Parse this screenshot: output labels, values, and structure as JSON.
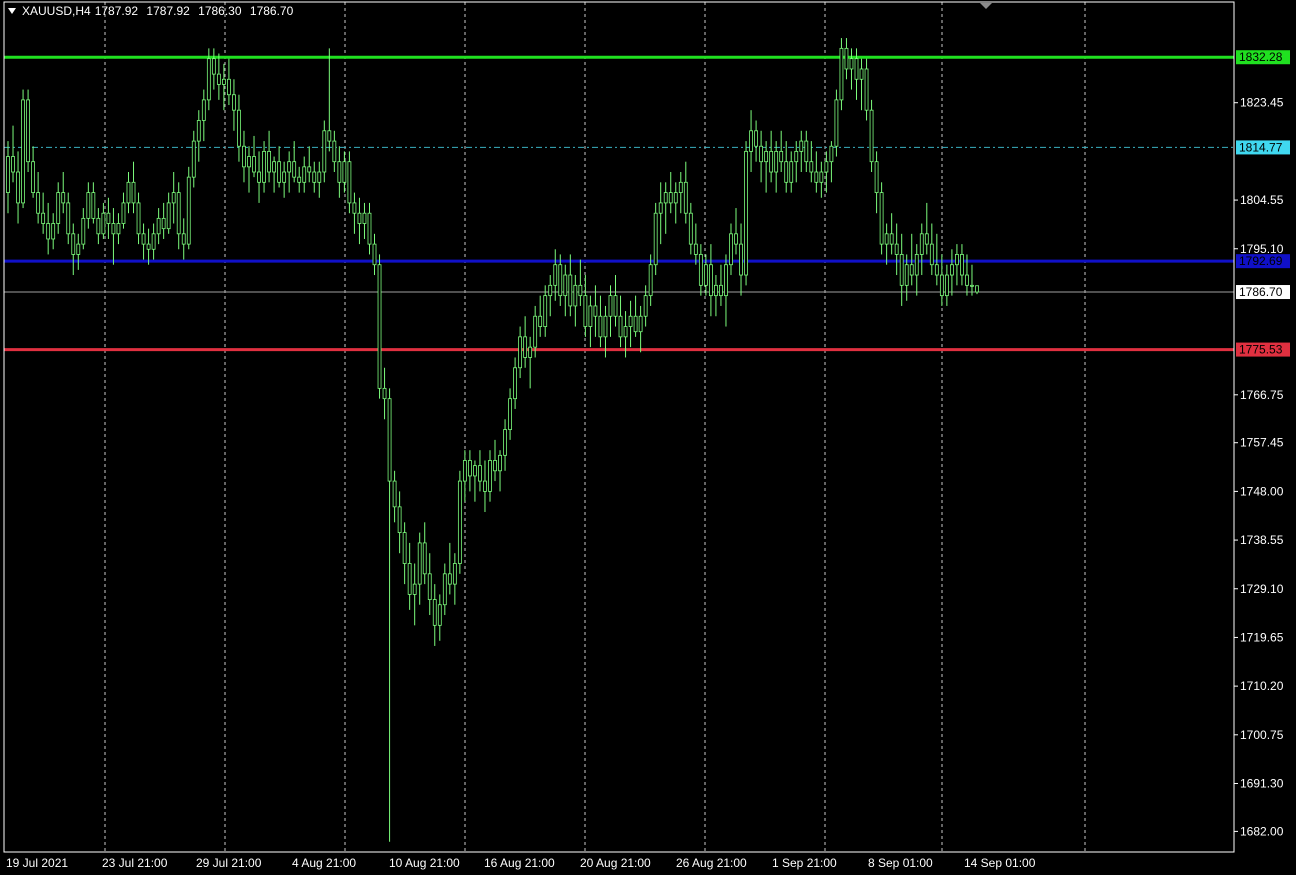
{
  "header": {
    "symbol_timeframe": "XAUUSD,H4",
    "open": "1787.92",
    "high": "1787.92",
    "low": "1786.30",
    "close": "1786.70"
  },
  "colors": {
    "background": "#000000",
    "frame": "#ffffff",
    "grid": "#c8c8c8",
    "candle": "#7cfc7c",
    "resistance_line": "#20e020",
    "dashed_level": "#3ab0c0",
    "blue_level": "#1010c8",
    "red_level": "#e03040",
    "bid_line": "#a0a0a0"
  },
  "chart_data": {
    "type": "candlestick",
    "symbol": "XAUUSD",
    "timeframe": "H4",
    "ylim": [
      1678.0,
      1843.0
    ],
    "y_ticks": [
      "1823.45",
      "1804.55",
      "1795.10",
      "1766.75",
      "1757.45",
      "1748.00",
      "1738.55",
      "1729.10",
      "1719.65",
      "1710.20",
      "1700.75",
      "1691.30",
      "1682.00"
    ],
    "x_ticks": [
      "19 Jul 2021",
      "23 Jul 21:00",
      "29 Jul 21:00",
      "4 Aug 21:00",
      "10 Aug 21:00",
      "16 Aug 21:00",
      "20 Aug 21:00",
      "26 Aug 21:00",
      "1 Sep 21:00",
      "8 Sep 01:00",
      "14 Sep 01:00"
    ],
    "grid": "vertical dashed",
    "levels": [
      {
        "id": "green",
        "price": "1832.28",
        "value": 1832.28,
        "style": "solid",
        "color": "#20e020",
        "label_bg": "#20e020",
        "label_fg": "#000000"
      },
      {
        "id": "cyan",
        "price": "1814.77",
        "value": 1814.77,
        "style": "dashdot",
        "color": "#3ab0c0",
        "label_bg": "#40d8f0",
        "label_fg": "#000000"
      },
      {
        "id": "blue",
        "price": "1792.69",
        "value": 1792.69,
        "style": "solid",
        "color": "#1010c8",
        "label_bg": "#1010c8",
        "label_fg": "#000000"
      },
      {
        "id": "red",
        "price": "1775.53",
        "value": 1775.53,
        "style": "solid",
        "color": "#e03040",
        "label_bg": "#e03040",
        "label_fg": "#000000"
      },
      {
        "id": "bid",
        "price": "1786.70",
        "value": 1786.7,
        "style": "thin",
        "color": "#a0a0a0",
        "label_bg": "#ffffff",
        "label_fg": "#000000"
      }
    ],
    "candles": [
      [
        1806,
        1816,
        1802,
        1813
      ],
      [
        1813,
        1819,
        1808,
        1810
      ],
      [
        1810,
        1814,
        1800,
        1804
      ],
      [
        1804,
        1826,
        1803,
        1824
      ],
      [
        1824,
        1826,
        1810,
        1812
      ],
      [
        1812,
        1815,
        1805,
        1806
      ],
      [
        1806,
        1810,
        1800,
        1802
      ],
      [
        1802,
        1806,
        1798,
        1800
      ],
      [
        1800,
        1804,
        1794,
        1797
      ],
      [
        1797,
        1802,
        1795,
        1800
      ],
      [
        1800,
        1808,
        1798,
        1806
      ],
      [
        1806,
        1810,
        1802,
        1804
      ],
      [
        1804,
        1806,
        1796,
        1798
      ],
      [
        1798,
        1800,
        1790,
        1794
      ],
      [
        1794,
        1798,
        1791,
        1796
      ],
      [
        1796,
        1803,
        1795,
        1801
      ],
      [
        1801,
        1808,
        1799,
        1806
      ],
      [
        1806,
        1808,
        1800,
        1801
      ],
      [
        1801,
        1803,
        1796,
        1798
      ],
      [
        1798,
        1804,
        1797,
        1802
      ],
      [
        1802,
        1805,
        1797,
        1800
      ],
      [
        1800,
        1803,
        1792,
        1798
      ],
      [
        1798,
        1802,
        1796,
        1800
      ],
      [
        1800,
        1806,
        1799,
        1804
      ],
      [
        1804,
        1810,
        1802,
        1808
      ],
      [
        1808,
        1812,
        1802,
        1804
      ],
      [
        1804,
        1806,
        1796,
        1798
      ],
      [
        1798,
        1800,
        1793,
        1796
      ],
      [
        1796,
        1799,
        1792,
        1795
      ],
      [
        1795,
        1800,
        1793,
        1798
      ],
      [
        1798,
        1803,
        1796,
        1801
      ],
      [
        1801,
        1804,
        1797,
        1799
      ],
      [
        1799,
        1806,
        1798,
        1804
      ],
      [
        1804,
        1810,
        1800,
        1806
      ],
      [
        1806,
        1808,
        1795,
        1798
      ],
      [
        1798,
        1801,
        1793,
        1796
      ],
      [
        1796,
        1811,
        1795,
        1809
      ],
      [
        1809,
        1818,
        1807,
        1816
      ],
      [
        1816,
        1822,
        1812,
        1820
      ],
      [
        1820,
        1826,
        1816,
        1824
      ],
      [
        1824,
        1834,
        1822,
        1832
      ],
      [
        1832,
        1834,
        1826,
        1829
      ],
      [
        1829,
        1833,
        1824,
        1827
      ],
      [
        1827,
        1831,
        1822,
        1828
      ],
      [
        1828,
        1832,
        1823,
        1825
      ],
      [
        1825,
        1828,
        1818,
        1822
      ],
      [
        1822,
        1825,
        1812,
        1815
      ],
      [
        1815,
        1818,
        1808,
        1811
      ],
      [
        1811,
        1815,
        1806,
        1813
      ],
      [
        1813,
        1817,
        1809,
        1810
      ],
      [
        1810,
        1814,
        1804,
        1808
      ],
      [
        1808,
        1816,
        1806,
        1814
      ],
      [
        1814,
        1818,
        1808,
        1810
      ],
      [
        1810,
        1813,
        1806,
        1812
      ],
      [
        1812,
        1815,
        1807,
        1808
      ],
      [
        1808,
        1812,
        1805,
        1810
      ],
      [
        1810,
        1814,
        1806,
        1812
      ],
      [
        1812,
        1816,
        1808,
        1809
      ],
      [
        1809,
        1811,
        1806,
        1808
      ],
      [
        1808,
        1813,
        1806,
        1811
      ],
      [
        1811,
        1815,
        1808,
        1810
      ],
      [
        1810,
        1812,
        1806,
        1808
      ],
      [
        1808,
        1812,
        1805,
        1810
      ],
      [
        1810,
        1820,
        1808,
        1818
      ],
      [
        1818,
        1834,
        1814,
        1816
      ],
      [
        1816,
        1818,
        1810,
        1812
      ],
      [
        1812,
        1815,
        1805,
        1808
      ],
      [
        1808,
        1814,
        1806,
        1812
      ],
      [
        1812,
        1814,
        1802,
        1804
      ],
      [
        1804,
        1806,
        1798,
        1802
      ],
      [
        1802,
        1805,
        1796,
        1800
      ],
      [
        1800,
        1804,
        1797,
        1802
      ],
      [
        1802,
        1804,
        1794,
        1796
      ],
      [
        1796,
        1798,
        1790,
        1792
      ],
      [
        1792,
        1794,
        1766,
        1768
      ],
      [
        1768,
        1772,
        1762,
        1766
      ],
      [
        1766,
        1768,
        1680,
        1750
      ],
      [
        1750,
        1752,
        1742,
        1745
      ],
      [
        1745,
        1748,
        1736,
        1740
      ],
      [
        1740,
        1742,
        1730,
        1734
      ],
      [
        1734,
        1738,
        1725,
        1728
      ],
      [
        1728,
        1734,
        1722,
        1730
      ],
      [
        1730,
        1740,
        1726,
        1738
      ],
      [
        1738,
        1742,
        1730,
        1732
      ],
      [
        1732,
        1736,
        1724,
        1727
      ],
      [
        1727,
        1730,
        1718,
        1722
      ],
      [
        1722,
        1728,
        1719,
        1726
      ],
      [
        1726,
        1734,
        1724,
        1732
      ],
      [
        1732,
        1738,
        1728,
        1730
      ],
      [
        1730,
        1736,
        1726,
        1734
      ],
      [
        1734,
        1752,
        1732,
        1750
      ],
      [
        1750,
        1756,
        1746,
        1754
      ],
      [
        1754,
        1756,
        1748,
        1751
      ],
      [
        1751,
        1754,
        1746,
        1753
      ],
      [
        1753,
        1756,
        1748,
        1750
      ],
      [
        1750,
        1754,
        1744,
        1748
      ],
      [
        1748,
        1756,
        1746,
        1754
      ],
      [
        1754,
        1758,
        1750,
        1752
      ],
      [
        1752,
        1756,
        1748,
        1755
      ],
      [
        1755,
        1762,
        1752,
        1760
      ],
      [
        1760,
        1768,
        1758,
        1766
      ],
      [
        1766,
        1774,
        1764,
        1772
      ],
      [
        1772,
        1780,
        1770,
        1778
      ],
      [
        1778,
        1782,
        1772,
        1774
      ],
      [
        1774,
        1778,
        1768,
        1776
      ],
      [
        1776,
        1784,
        1774,
        1782
      ],
      [
        1782,
        1786,
        1778,
        1780
      ],
      [
        1780,
        1788,
        1778,
        1786
      ],
      [
        1786,
        1790,
        1782,
        1788
      ],
      [
        1788,
        1795,
        1785,
        1792
      ],
      [
        1792,
        1794,
        1784,
        1786
      ],
      [
        1786,
        1792,
        1782,
        1790
      ],
      [
        1790,
        1794,
        1782,
        1784
      ],
      [
        1784,
        1790,
        1780,
        1788
      ],
      [
        1788,
        1793,
        1784,
        1786
      ],
      [
        1786,
        1790,
        1778,
        1780
      ],
      [
        1780,
        1786,
        1776,
        1784
      ],
      [
        1784,
        1788,
        1778,
        1782
      ],
      [
        1782,
        1786,
        1776,
        1778
      ],
      [
        1778,
        1784,
        1774,
        1782
      ],
      [
        1782,
        1788,
        1778,
        1786
      ],
      [
        1786,
        1790,
        1780,
        1782
      ],
      [
        1782,
        1786,
        1776,
        1778
      ],
      [
        1778,
        1783,
        1774,
        1780
      ],
      [
        1780,
        1785,
        1776,
        1782
      ],
      [
        1782,
        1786,
        1778,
        1779
      ],
      [
        1779,
        1784,
        1775,
        1782
      ],
      [
        1782,
        1788,
        1780,
        1786
      ],
      [
        1786,
        1794,
        1784,
        1792
      ],
      [
        1792,
        1804,
        1790,
        1802
      ],
      [
        1802,
        1808,
        1796,
        1804
      ],
      [
        1804,
        1808,
        1798,
        1806
      ],
      [
        1806,
        1810,
        1802,
        1804
      ],
      [
        1804,
        1808,
        1800,
        1806
      ],
      [
        1806,
        1810,
        1802,
        1808
      ],
      [
        1808,
        1812,
        1800,
        1802
      ],
      [
        1802,
        1804,
        1794,
        1796
      ],
      [
        1796,
        1800,
        1792,
        1794
      ],
      [
        1794,
        1796,
        1786,
        1788
      ],
      [
        1788,
        1794,
        1786,
        1792
      ],
      [
        1792,
        1796,
        1782,
        1786
      ],
      [
        1786,
        1790,
        1782,
        1788
      ],
      [
        1788,
        1792,
        1784,
        1786
      ],
      [
        1786,
        1794,
        1780,
        1792
      ],
      [
        1792,
        1800,
        1790,
        1798
      ],
      [
        1798,
        1803,
        1794,
        1796
      ],
      [
        1796,
        1800,
        1786,
        1790
      ],
      [
        1790,
        1816,
        1788,
        1814
      ],
      [
        1814,
        1822,
        1810,
        1818
      ],
      [
        1818,
        1820,
        1812,
        1815
      ],
      [
        1815,
        1818,
        1808,
        1812
      ],
      [
        1812,
        1816,
        1806,
        1814
      ],
      [
        1814,
        1818,
        1808,
        1810
      ],
      [
        1810,
        1816,
        1806,
        1814
      ],
      [
        1814,
        1818,
        1810,
        1812
      ],
      [
        1812,
        1816,
        1806,
        1808
      ],
      [
        1808,
        1814,
        1806,
        1812
      ],
      [
        1812,
        1816,
        1808,
        1814
      ],
      [
        1814,
        1818,
        1810,
        1816
      ],
      [
        1816,
        1818,
        1810,
        1812
      ],
      [
        1812,
        1816,
        1808,
        1810
      ],
      [
        1810,
        1814,
        1806,
        1808
      ],
      [
        1808,
        1812,
        1805,
        1810
      ],
      [
        1810,
        1814,
        1806,
        1812
      ],
      [
        1812,
        1816,
        1808,
        1815
      ],
      [
        1815,
        1826,
        1813,
        1824
      ],
      [
        1824,
        1836,
        1822,
        1834
      ],
      [
        1834,
        1836,
        1828,
        1830
      ],
      [
        1830,
        1834,
        1826,
        1832
      ],
      [
        1832,
        1834,
        1824,
        1828
      ],
      [
        1828,
        1832,
        1822,
        1830
      ],
      [
        1830,
        1832,
        1820,
        1822
      ],
      [
        1822,
        1824,
        1810,
        1812
      ],
      [
        1812,
        1814,
        1802,
        1806
      ],
      [
        1806,
        1808,
        1794,
        1796
      ],
      [
        1796,
        1800,
        1792,
        1798
      ],
      [
        1798,
        1802,
        1794,
        1796
      ],
      [
        1796,
        1800,
        1790,
        1794
      ],
      [
        1794,
        1798,
        1784,
        1788
      ],
      [
        1788,
        1794,
        1785,
        1792
      ],
      [
        1792,
        1798,
        1788,
        1790
      ],
      [
        1790,
        1796,
        1786,
        1794
      ],
      [
        1794,
        1800,
        1790,
        1798
      ],
      [
        1798,
        1804,
        1794,
        1796
      ],
      [
        1796,
        1800,
        1790,
        1792
      ],
      [
        1792,
        1798,
        1788,
        1790
      ],
      [
        1790,
        1794,
        1784,
        1786
      ],
      [
        1786,
        1792,
        1784,
        1790
      ],
      [
        1790,
        1795,
        1786,
        1792
      ],
      [
        1792,
        1796,
        1788,
        1794
      ],
      [
        1794,
        1796,
        1788,
        1790
      ],
      [
        1790,
        1794,
        1786,
        1788
      ],
      [
        1788,
        1792,
        1786,
        1787.92
      ],
      [
        1787.92,
        1787.92,
        1786.3,
        1786.7
      ]
    ]
  }
}
